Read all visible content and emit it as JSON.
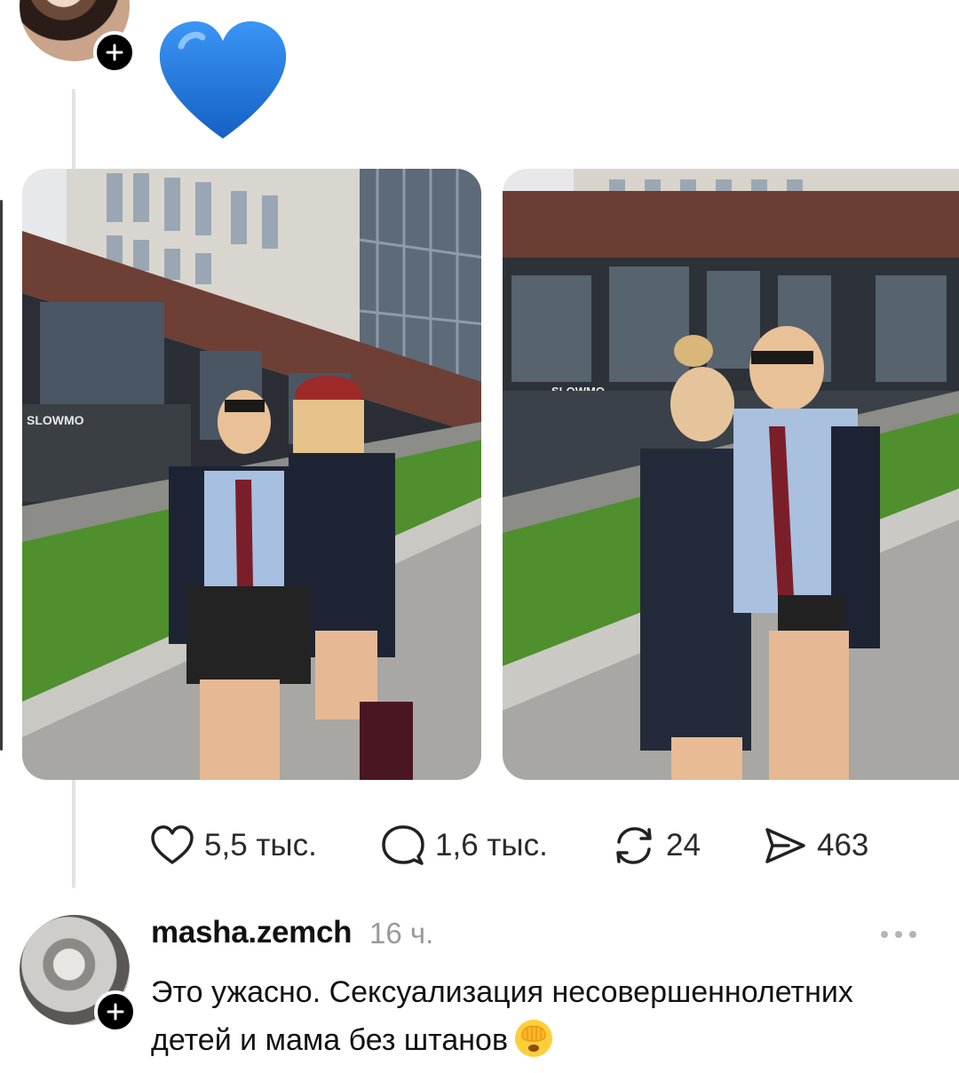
{
  "post": {
    "author_avatar": "user-avatar-image",
    "follow_icon": "plus-icon",
    "text_emoji": "blue-heart-emoji",
    "photos": [
      {
        "name": "photo-woman-and-girl-school-uniform-1"
      },
      {
        "name": "photo-woman-and-girl-school-uniform-2"
      }
    ],
    "actions": {
      "like_count": "5,5 тыс.",
      "comment_count": "1,6 тыс.",
      "repost_count": "24",
      "share_count": "463"
    }
  },
  "comment": {
    "username": "masha.zemch",
    "time": "16 ч.",
    "text": "Это ужасно. Сексуализация несовершеннолетних детей и мама без штанов",
    "emoji": "face-with-hand-over-eyes-emoji",
    "more_icon": "more-dots-icon"
  },
  "colors": {
    "accent": "#000000",
    "muted_text": "#9a9a9a",
    "heart": "#1e7be0"
  }
}
